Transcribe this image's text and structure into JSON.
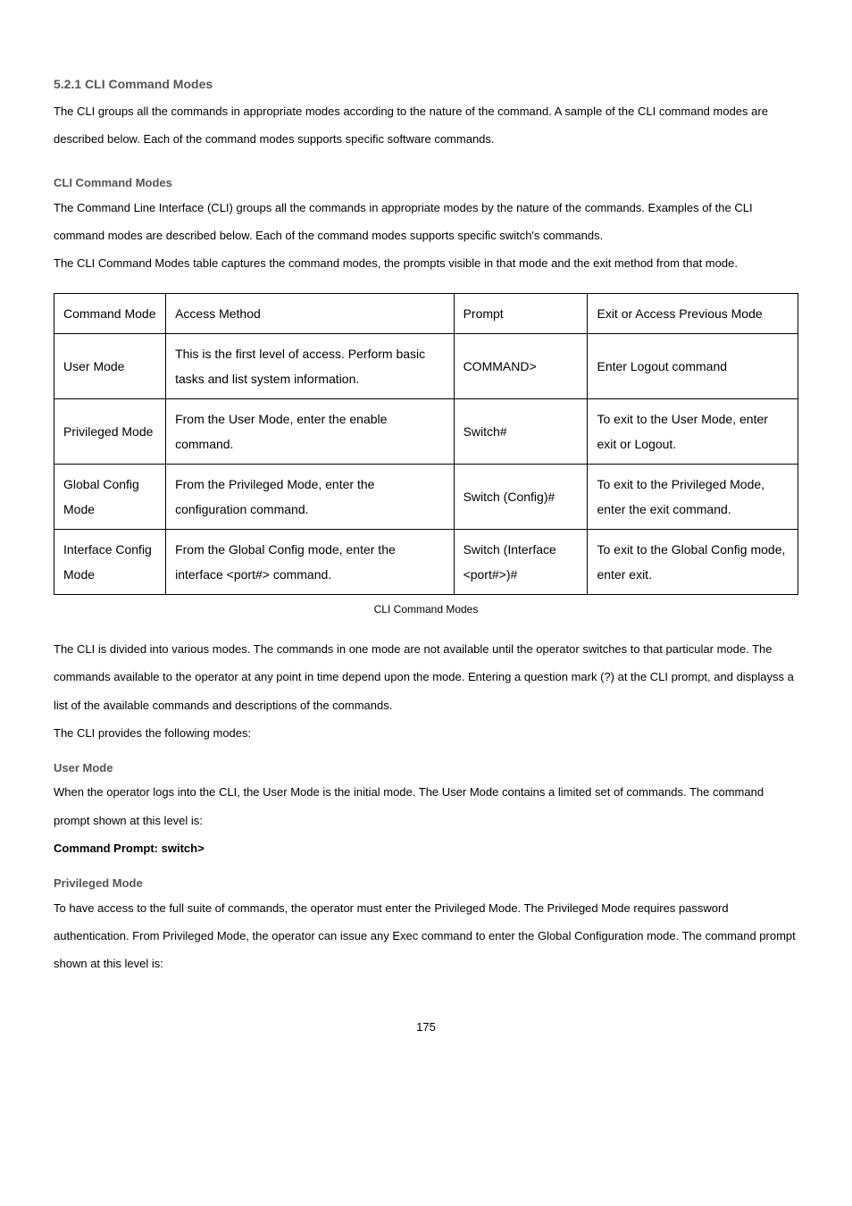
{
  "section_heading": "5.2.1 CLI Command Modes",
  "intro": "The CLI groups all the commands in appropriate modes according to the nature of the command. A sample of the CLI command modes are described below. Each of the command modes supports specific software commands.",
  "sub_heading": "CLI Command Modes",
  "para2_prefix": "The ",
  "para2_em": "Command Line Interface (CLI)",
  "para2_rest": " groups all the commands in appropriate modes by the nature of the commands. Examples of the CLI command modes are described below. Each of the command modes supports specific switch's commands.",
  "para3": "The CLI Command Modes table captures the command modes, the prompts visible in that mode and the exit method from that mode.",
  "table": {
    "headers": {
      "col1": "Command Mode",
      "col2": "Access Method",
      "col3": "Prompt",
      "col4": "Exit or Access Previous Mode"
    },
    "rows": [
      {
        "mode": "User Mode",
        "access": "This is the first level of access. Perform basic tasks and list system information.",
        "prompt": "COMMAND>",
        "exit": "Enter Logout command"
      },
      {
        "mode": "Privileged Mode",
        "access": "From the User Mode, enter the enable command.",
        "prompt": "Switch#",
        "exit": "To exit to the User Mode, enter exit or Logout."
      },
      {
        "mode": "Global Config Mode",
        "access": "From the Privileged Mode, enter the configuration command.",
        "prompt": "Switch (Config)#",
        "exit": "To exit to the Privileged Mode, enter the exit command."
      },
      {
        "mode": "Interface Config Mode",
        "access": "From the Global Config mode, enter the interface <port#> command.",
        "prompt": "Switch (Interface <port#>)#",
        "exit": "To exit to the Global Config mode, enter exit."
      }
    ]
  },
  "caption": "CLI Command Modes",
  "para_modes1": "The CLI is divided into various modes. The commands in one mode are not available until the operator switches to that particular mode. The commands available to the operator at any point in time depend upon the mode. Entering a question mark (?) at the CLI prompt, and displayss a list of the available commands and descriptions of the commands.",
  "para_modes2": "The CLI provides the following modes:",
  "user_mode_heading": "User Mode",
  "user_mode_para": "When the operator logs into the CLI, the User Mode is the initial mode. The User Mode contains a limited set of commands. The command prompt shown at this level is:",
  "user_mode_prompt": "Command Prompt: switch>",
  "priv_mode_heading": "Privileged Mode",
  "priv_mode_para": "To have access to the full suite of commands, the operator must enter the Privileged Mode. The Privileged Mode requires password authentication. From Privileged Mode, the operator can issue any Exec command to enter the Global Configuration mode. The command prompt shown at this level is:",
  "page_number": "175"
}
